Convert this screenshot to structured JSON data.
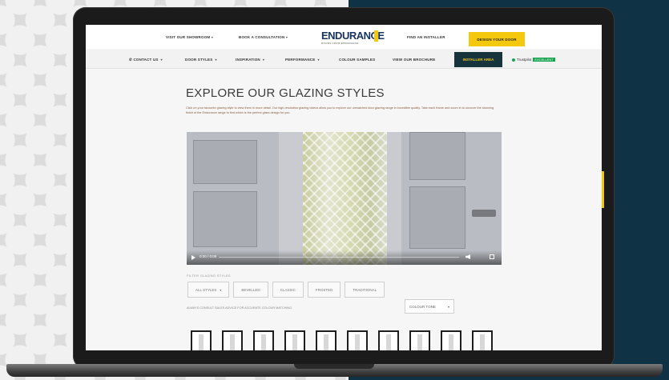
{
  "topbar": {
    "links": [
      "VISIT OUR SHOWROOM",
      "BOOK A CONSULTATION",
      "FIND AN INSTALLER"
    ],
    "logo": "ENDURANCE",
    "logo_tagline": "DOORS FROM ENDURANCE",
    "design_button": "DESIGN YOUR DOOR"
  },
  "nav": {
    "items": [
      "CONTACT US",
      "DOOR STYLES",
      "INSPIRATION",
      "PERFORMANCE",
      "COLOUR SAMPLES",
      "VIEW OUR BROCHURE"
    ],
    "installer_button": "INSTALLER AREA",
    "support_text": "Trustpilot",
    "support_rating": "EXCELLENT"
  },
  "page": {
    "heading": "EXPLORE OUR GLAZING STYLES",
    "intro": "Click on your favourite glazing style to view them in more detail. Our high-resolution glazing videos allow you to explore our unmatched door glazing range in incredible quality. Take each frame and zoom in to uncover the stunning finish of the Endurance range to find which is the perfect glass design for you.",
    "video_time": "0:00 / 0:09"
  },
  "filters": {
    "label": "FILTER GLAZING STYLES",
    "options": [
      "ALL STYLES",
      "BEVELLED",
      "CLASSIC",
      "FROSTED",
      "TRADITIONAL"
    ],
    "notice": "ALWAYS CONSULT SALES ADVICE FOR ACCURATE COLOUR MATCHING",
    "colour_select": "COLOUR TONE"
  },
  "thumbnails": {
    "count": 10
  },
  "colors": {
    "navy": "#0f3245",
    "accent_yellow": "#f3c80d",
    "logo_blue": "#17345f",
    "installer_bg": "#17343d",
    "trustpilot_green": "#14a44d"
  }
}
